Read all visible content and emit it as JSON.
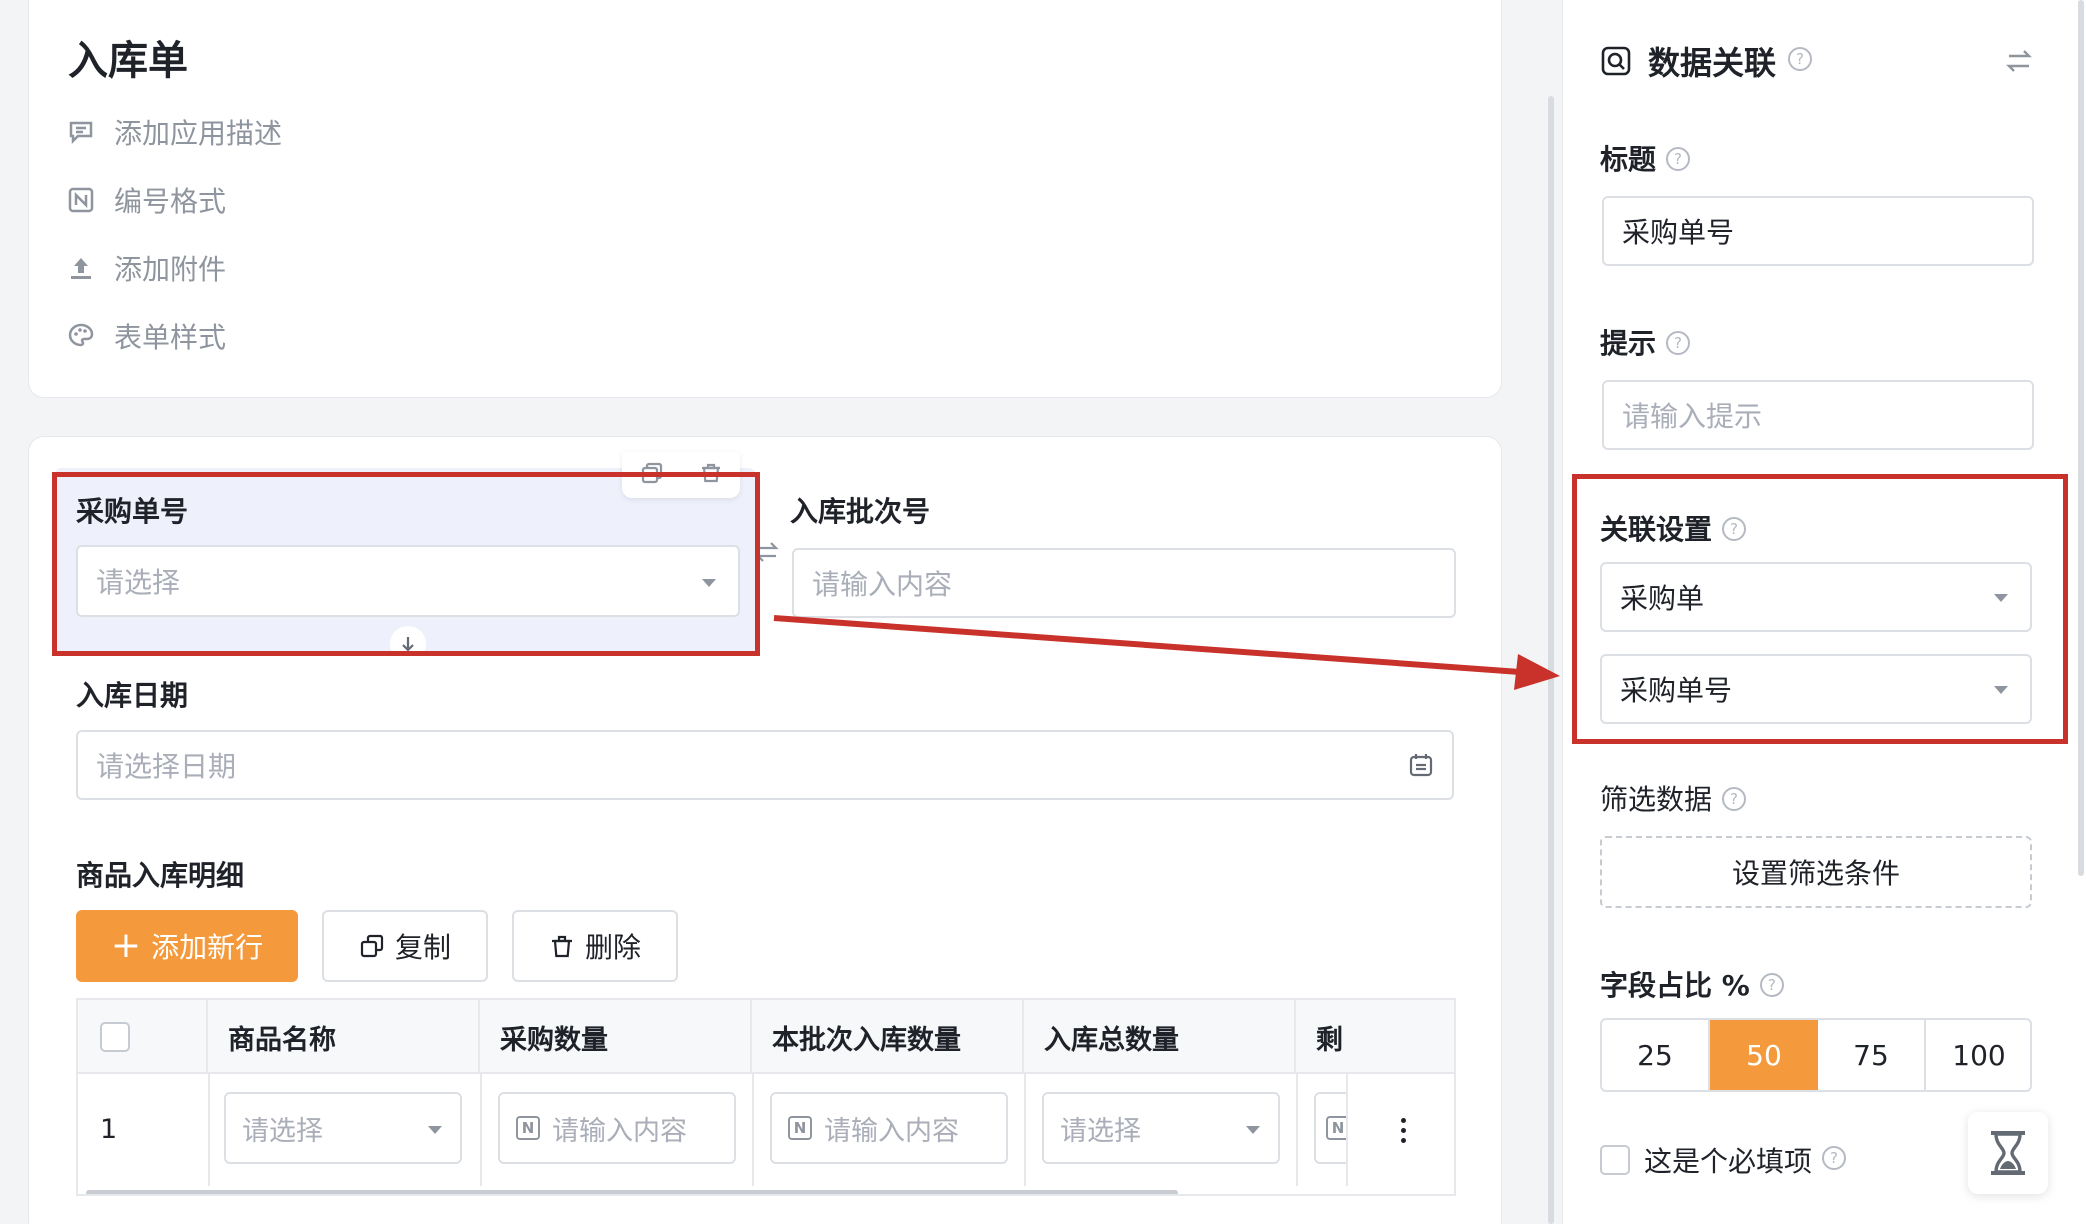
{
  "form": {
    "title": "入库单",
    "menu": [
      {
        "label": "添加应用描述",
        "icon": "comment-icon"
      },
      {
        "label": "编号格式",
        "icon": "number-format-icon"
      },
      {
        "label": "添加附件",
        "icon": "upload-icon"
      },
      {
        "label": "表单样式",
        "icon": "palette-icon"
      }
    ]
  },
  "fields": {
    "purchase_no": {
      "label": "采购单号",
      "placeholder": "请选择"
    },
    "batch_no": {
      "label": "入库批次号",
      "placeholder": "请输入内容"
    },
    "date": {
      "label": "入库日期",
      "placeholder": "请选择日期"
    },
    "detail": {
      "label": "商品入库明细",
      "add_label": "添加新行",
      "copy_label": "复制",
      "delete_label": "删除",
      "columns": [
        "商品名称",
        "采购数量",
        "本批次入库数量",
        "入库总数量",
        "剩"
      ],
      "row": {
        "index": "1",
        "name_placeholder": "请选择",
        "qty_placeholder": "请输入内容",
        "batch_qty_placeholder": "请输入内容",
        "total_placeholder": "请选择"
      }
    }
  },
  "panel": {
    "title": "数据关联",
    "title_label": "标题",
    "title_value": "采购单号",
    "hint_label": "提示",
    "hint_placeholder": "请输入提示",
    "relation_label": "关联设置",
    "relation_form": "采购单",
    "relation_field": "采购单号",
    "filter_label": "筛选数据",
    "filter_button": "设置筛选条件",
    "ratio_label": "字段占比 %",
    "ratio_options": [
      "25",
      "50",
      "75",
      "100"
    ],
    "ratio_selected": "50",
    "required_label": "这是个必填项"
  },
  "colors": {
    "accent": "#f59a3c",
    "annotation": "#c8322b",
    "selected_field_bg": "#eef0fb"
  }
}
